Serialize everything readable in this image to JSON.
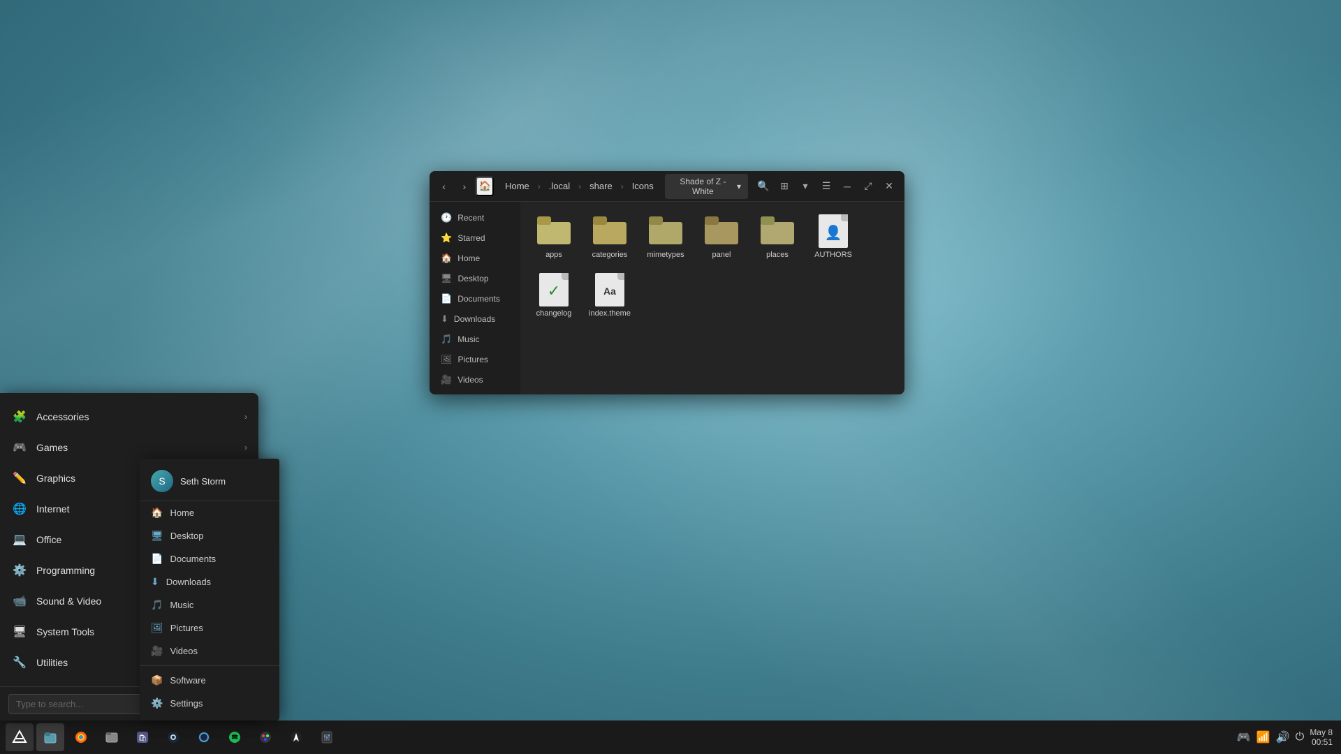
{
  "desktop": {
    "bg_color": "#5a9aaa"
  },
  "taskbar": {
    "apps": [
      {
        "name": "zorin-menu",
        "label": "Z",
        "icon": "⬡"
      },
      {
        "name": "files",
        "icon": "🗂"
      },
      {
        "name": "firefox",
        "icon": "🦊"
      },
      {
        "name": "nautilus",
        "icon": "📁"
      },
      {
        "name": "software-center",
        "icon": "🛍"
      },
      {
        "name": "steam",
        "icon": "♟"
      },
      {
        "name": "zorinos-appearance",
        "icon": "🎨"
      },
      {
        "name": "spotify",
        "icon": "♪"
      },
      {
        "name": "app8",
        "icon": "🎨"
      },
      {
        "name": "app9",
        "icon": "⬡"
      },
      {
        "name": "app10",
        "icon": "🎛"
      }
    ],
    "tray": {
      "gamepad": "🎮",
      "network": "📶",
      "volume": "🔊",
      "power": "⏻"
    },
    "date": "May 8",
    "time": "00:51"
  },
  "app_menu": {
    "categories": [
      {
        "id": "accessories",
        "label": "Accessories",
        "icon": "🧩",
        "has_sub": true
      },
      {
        "id": "games",
        "label": "Games",
        "icon": "🎮",
        "has_sub": true
      },
      {
        "id": "graphics",
        "label": "Graphics",
        "icon": "✏️",
        "has_sub": true
      },
      {
        "id": "internet",
        "label": "Internet",
        "icon": "🌐",
        "has_sub": true
      },
      {
        "id": "office",
        "label": "Office",
        "icon": "💻",
        "has_sub": true
      },
      {
        "id": "programming",
        "label": "Programming",
        "icon": "⚙️",
        "has_sub": true
      },
      {
        "id": "sound-video",
        "label": "Sound & Video",
        "icon": "📹",
        "has_sub": true
      },
      {
        "id": "system-tools",
        "label": "System Tools",
        "icon": "🖥",
        "has_sub": true
      },
      {
        "id": "utilities",
        "label": "Utilities",
        "icon": "🔧",
        "has_sub": true
      }
    ],
    "search_placeholder": "Type to search...",
    "action_buttons": [
      "lock",
      "restart",
      "shutdown"
    ]
  },
  "user_submenu": {
    "name": "Seth Storm",
    "items": [
      {
        "id": "home",
        "label": "Home",
        "icon": "🏠"
      },
      {
        "id": "desktop",
        "label": "Desktop",
        "icon": "🖥"
      },
      {
        "id": "documents",
        "label": "Documents",
        "icon": "📄"
      },
      {
        "id": "downloads",
        "label": "Downloads",
        "icon": "⬇"
      },
      {
        "id": "music",
        "label": "Music",
        "icon": "🎵"
      },
      {
        "id": "pictures",
        "label": "Pictures",
        "icon": "🖼"
      },
      {
        "id": "videos",
        "label": "Videos",
        "icon": "🎥"
      }
    ],
    "bottom_items": [
      {
        "id": "software",
        "label": "Software",
        "icon": "📦"
      },
      {
        "id": "settings",
        "label": "Settings",
        "icon": "⚙️"
      }
    ]
  },
  "file_manager": {
    "title": "Icons",
    "breadcrumb": [
      "Home",
      ".local",
      "share",
      "Icons"
    ],
    "theme_label": "Shade of Z - White",
    "sidebar_items": [
      {
        "id": "recent",
        "label": "Recent",
        "icon": "🕐"
      },
      {
        "id": "starred",
        "label": "Starred",
        "icon": "⭐"
      },
      {
        "id": "home",
        "label": "Home",
        "icon": "🏠"
      },
      {
        "id": "desktop",
        "label": "Desktop",
        "icon": "🖥"
      },
      {
        "id": "documents",
        "label": "Documents",
        "icon": "📄"
      },
      {
        "id": "downloads",
        "label": "Downloads",
        "icon": "⬇"
      },
      {
        "id": "music",
        "label": "Music",
        "icon": "🎵"
      },
      {
        "id": "pictures",
        "label": "Pictures",
        "icon": "🖼"
      },
      {
        "id": "videos",
        "label": "Videos",
        "icon": "🎥"
      }
    ],
    "files": [
      {
        "id": "apps",
        "label": "apps",
        "type": "folder"
      },
      {
        "id": "categories",
        "label": "categories",
        "type": "folder"
      },
      {
        "id": "mimetypes",
        "label": "mimetypes",
        "type": "folder"
      },
      {
        "id": "panel",
        "label": "panel",
        "type": "folder"
      },
      {
        "id": "places",
        "label": "places",
        "type": "folder"
      },
      {
        "id": "authors",
        "label": "AUTHORS",
        "type": "file-person"
      },
      {
        "id": "changelog",
        "label": "changelog",
        "type": "file-check"
      },
      {
        "id": "index-theme",
        "label": "index.theme",
        "type": "file-theme"
      }
    ]
  }
}
